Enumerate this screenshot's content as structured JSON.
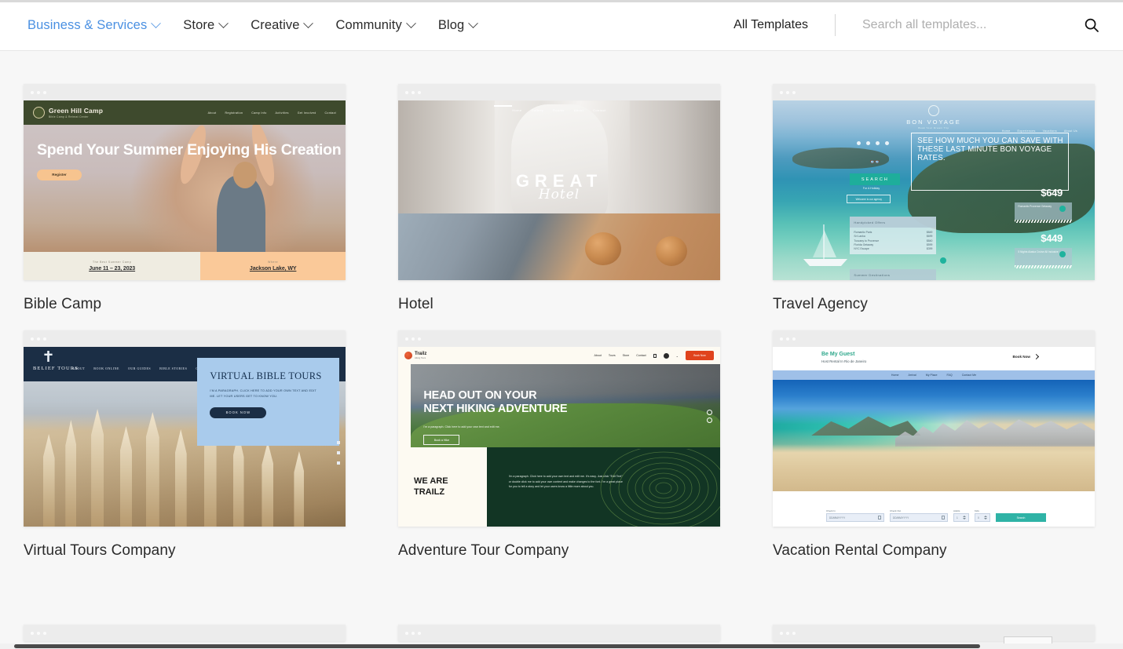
{
  "header": {
    "nav": [
      {
        "label": "Business & Services",
        "active": true,
        "icon": "chevron-down-icon"
      },
      {
        "label": "Store",
        "active": false,
        "icon": "chevron-down-icon"
      },
      {
        "label": "Creative",
        "active": false,
        "icon": "chevron-down-icon"
      },
      {
        "label": "Community",
        "active": false,
        "icon": "chevron-down-icon"
      },
      {
        "label": "Blog",
        "active": false,
        "icon": "chevron-down-icon"
      }
    ],
    "all_templates": "All Templates",
    "search_placeholder": "Search all templates...",
    "search_value": "",
    "search_icon": "search-icon",
    "accent_color": "#4a90e2"
  },
  "templates": [
    {
      "title": "Bible Camp",
      "brand": "Green Hill Camp",
      "brand_sub": "Bible Camp & Retreat Center",
      "nav": [
        "About",
        "Registration",
        "Camp Info",
        "Activities",
        "Get Involved",
        "Contact"
      ],
      "headline": "Spend Your Summer Enjoying His Creation",
      "cta": "Register",
      "info": [
        {
          "label": "The Best Summer Camp",
          "value": "June 11 – 23, 2023"
        },
        {
          "label": "Where",
          "value": "Jackson Lake, WY"
        }
      ],
      "nav_color": "#3e4a2d",
      "cta_color": "#f7c48f"
    },
    {
      "title": "Hotel",
      "brand_top": "GREAT",
      "brand_bottom": "Hotel",
      "nav": [
        "Home",
        "Gallery",
        "Rooms",
        "About",
        "Contact"
      ]
    },
    {
      "title": "Travel Agency",
      "brand": "BON VOYAGE",
      "brand_sub": "Book Your Dream Trip",
      "nav": [
        "Home",
        "Experiences",
        "Vacations",
        "About Us"
      ],
      "banner": "SEE HOW MUCH YOU CAN SAVE WITH THESE LAST MINUTE BON VOYAGE RATES.",
      "search_btn": "SEARCH",
      "search_sub": "For A Holiday",
      "welcome": "Welcome to our agency",
      "offers_title": "Handpicked Offers",
      "offers": [
        {
          "name": "Romantic Paris",
          "price": "$849"
        },
        {
          "name": "Sri Lanka",
          "price": "$699"
        },
        {
          "name": "Tuscany to Provence",
          "price": "$840"
        },
        {
          "name": "Florida Getaway",
          "price": "$599"
        },
        {
          "name": "NYC Escape",
          "price": "$399"
        }
      ],
      "destinations_title": "Summer Destinations",
      "deals": [
        {
          "price": "$649",
          "desc": "Romantic Provence Getaway"
        },
        {
          "price": "$449",
          "desc": "5 Nights Alaska Cruise All Inclusive"
        }
      ],
      "accent_color": "#1eae9b"
    },
    {
      "title": "Virtual Tours Company",
      "brand": "BELIEF TOURS",
      "nav": [
        "ABOUT",
        "BOOK ONLINE",
        "OUR GUIDES",
        "BIBLE STORIES",
        "CONTACT"
      ],
      "panel_heading": "VIRTUAL BIBLE TOURS",
      "panel_text": "I'M A PARAGRAPH. CLICK HERE TO ADD YOUR OWN TEXT AND EDIT ME. LET YOUR USERS GET TO KNOW YOU.",
      "cta": "BOOK NOW",
      "nav_color": "#1b2e45",
      "panel_color": "#a9cbec"
    },
    {
      "title": "Adventure Tour Company",
      "brand": "Trailz",
      "brand_sub": "Hiking Tours",
      "nav": [
        "About",
        "Tours",
        "Store",
        "Contact"
      ],
      "book_btn": "Book Now",
      "headline_1": "HEAD OUT ON YOUR",
      "headline_2": "NEXT HIKING ADVENTURE",
      "sub": "I'm a paragraph. Click here to add your own text and edit me.",
      "cta": "Book a Hike",
      "section_heading_1": "WE ARE",
      "section_heading_2": "TRAILZ",
      "section_text": "I'm a paragraph. Click here to add your own text and edit me. It's easy. Just click \"Edit Text\" or double click me to add your own content and make changes to the font. I'm a great place for you to tell a story and let your users know a little more about you.",
      "accent_color": "#e0431c",
      "panel_color": "#123524"
    },
    {
      "title": "Vacation Rental Company",
      "brand": "Be My Guest",
      "brand_sub": "Host Rental In Rio de Janeiro",
      "book_btn": "Book Now",
      "nav": [
        "Home",
        "Arrival",
        "My Place",
        "FAQ",
        "Contact Me"
      ],
      "form": {
        "checkin_label": "Check In",
        "checkin_value": "DD/MM/YYYY",
        "checkout_label": "Check Out",
        "checkout_value": "DD/MM/YYYY",
        "adults_label": "Adults",
        "adults_value": "1",
        "kids_label": "Kids",
        "kids_value": "0",
        "search_btn": "Search"
      },
      "accent_color": "#2fb3a6"
    }
  ]
}
